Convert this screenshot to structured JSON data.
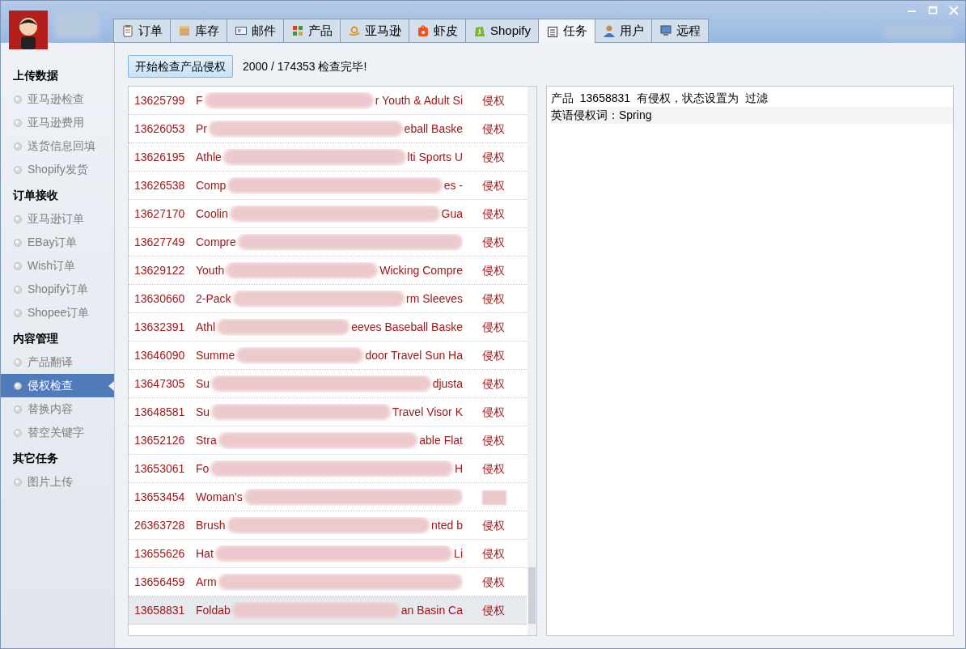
{
  "tabs": [
    {
      "label": "订单",
      "selected": false
    },
    {
      "label": "库存",
      "selected": false
    },
    {
      "label": "邮件",
      "selected": false
    },
    {
      "label": "产品",
      "selected": false
    },
    {
      "label": "亚马逊",
      "selected": false
    },
    {
      "label": "虾皮",
      "selected": false
    },
    {
      "label": "Shopify",
      "selected": false
    },
    {
      "label": "任务",
      "selected": true
    },
    {
      "label": "用户",
      "selected": false
    },
    {
      "label": "远程",
      "selected": false
    }
  ],
  "sidebar": {
    "sections": [
      {
        "title": "上传数据",
        "items": [
          {
            "label": "亚马逊检查",
            "selected": false
          },
          {
            "label": "亚马逊费用",
            "selected": false
          },
          {
            "label": "送货信息回填",
            "selected": false
          },
          {
            "label": "Shopify发货",
            "selected": false
          }
        ]
      },
      {
        "title": "订单接收",
        "items": [
          {
            "label": "亚马逊订单",
            "selected": false
          },
          {
            "label": "EBay订单",
            "selected": false
          },
          {
            "label": "Wish订单",
            "selected": false
          },
          {
            "label": "Shopify订单",
            "selected": false
          },
          {
            "label": "Shopee订单",
            "selected": false
          }
        ]
      },
      {
        "title": "内容管理",
        "items": [
          {
            "label": "产品翻译",
            "selected": false
          },
          {
            "label": "侵权检查",
            "selected": true
          },
          {
            "label": "替换内容",
            "selected": false
          },
          {
            "label": "替空关键字",
            "selected": false
          }
        ]
      },
      {
        "title": "其它任务",
        "items": [
          {
            "label": "图片上传",
            "selected": false
          }
        ]
      }
    ]
  },
  "toolbar": {
    "button": "开始检查产品侵权",
    "progress": "2000 / 174353 检查完毕!"
  },
  "results": [
    {
      "id": "13625799",
      "title_head": "F",
      "title_tail": "r Youth & Adult Si",
      "status": "侵权",
      "selected": false
    },
    {
      "id": "13626053",
      "title_head": "Pr",
      "title_tail": "eball Baske",
      "status": "侵权",
      "selected": false
    },
    {
      "id": "13626195",
      "title_head": "Athle",
      "title_tail": "lti Sports U",
      "status": "侵权",
      "selected": false
    },
    {
      "id": "13626538",
      "title_head": "Comp",
      "title_tail": "es -",
      "status": "侵权",
      "selected": false
    },
    {
      "id": "13627170",
      "title_head": "Coolin",
      "title_tail": "Gua",
      "status": "侵权",
      "selected": false
    },
    {
      "id": "13627749",
      "title_head": "Compre",
      "status": "侵权",
      "selected": false
    },
    {
      "id": "13629122",
      "title_head": "Youth",
      "title_tail": "Wicking Compre",
      "status": "侵权",
      "selected": false
    },
    {
      "id": "13630660",
      "title_head": "2-Pack",
      "title_tail": "rm Sleeves",
      "status": "侵权",
      "selected": false
    },
    {
      "id": "13632391",
      "title_head": "Athl",
      "title_tail": "eeves Baseball Baske",
      "status": "侵权",
      "selected": false
    },
    {
      "id": "13646090",
      "title_head": "Summe",
      "title_tail": "door Travel Sun Ha",
      "status": "侵权",
      "selected": false
    },
    {
      "id": "13647305",
      "title_head": "Su",
      "title_tail": "djusta",
      "status": "侵权",
      "selected": false
    },
    {
      "id": "13648581",
      "title_head": "Su",
      "title_tail": "Travel Visor K",
      "status": "侵权",
      "selected": false
    },
    {
      "id": "13652126",
      "title_head": "Stra",
      "title_tail": "able Flat",
      "status": "侵权",
      "selected": false
    },
    {
      "id": "13653061",
      "title_head": "Fo",
      "title_tail": "H",
      "status": "侵权",
      "selected": false
    },
    {
      "id": "13653454",
      "title_head": "Woman's",
      "selected": false
    },
    {
      "id": "26363728",
      "title_head": "Brush",
      "title_tail": "nted b",
      "status": "侵权",
      "selected": false
    },
    {
      "id": "13655626",
      "title_head": "Hat",
      "title_tail": "Li",
      "status": "侵权",
      "selected": false
    },
    {
      "id": "13656459",
      "title_head": "Arm",
      "status": "侵权",
      "selected": false
    },
    {
      "id": "13658831",
      "title_head": "Foldab",
      "title_tail": "an Basin Ca",
      "status": "侵权",
      "selected": true
    }
  ],
  "log": [
    "产品  13658831  有侵权，状态设置为  过滤",
    "英语侵权词：Spring"
  ]
}
